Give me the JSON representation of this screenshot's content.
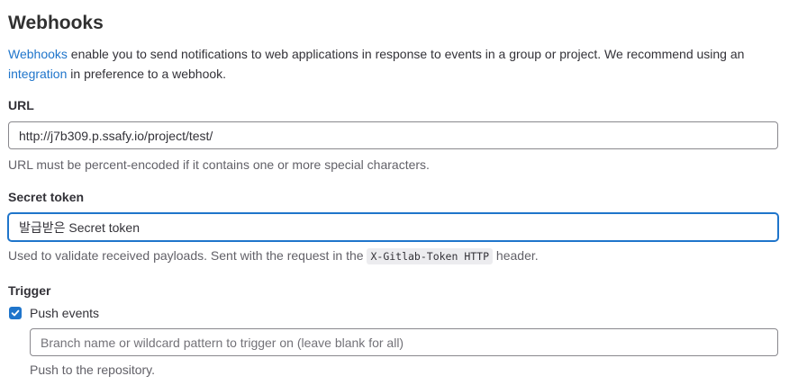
{
  "title": "Webhooks",
  "description": {
    "link1": "Webhooks",
    "text1": " enable you to send notifications to web applications in response to events in a group or project. We recommend using an ",
    "link2": "integration",
    "text2": " in preference to a webhook."
  },
  "url": {
    "label": "URL",
    "value": "http://j7b309.p.ssafy.io/project/test/",
    "help": "URL must be percent-encoded if it contains one or more special characters."
  },
  "secret_token": {
    "label": "Secret token",
    "value": "발급받은 Secret token",
    "help_before": "Used to validate received payloads. Sent with the request in the ",
    "help_code": "X-Gitlab-Token HTTP",
    "help_after": " header."
  },
  "trigger": {
    "label": "Trigger",
    "push_events": {
      "label": "Push events",
      "checked": true,
      "branch_placeholder": "Branch name or wildcard pattern to trigger on (leave blank for all)",
      "help": "Push to the repository."
    }
  },
  "colors": {
    "accent": "#1f75cb",
    "text": "#333238",
    "muted": "#626168"
  }
}
